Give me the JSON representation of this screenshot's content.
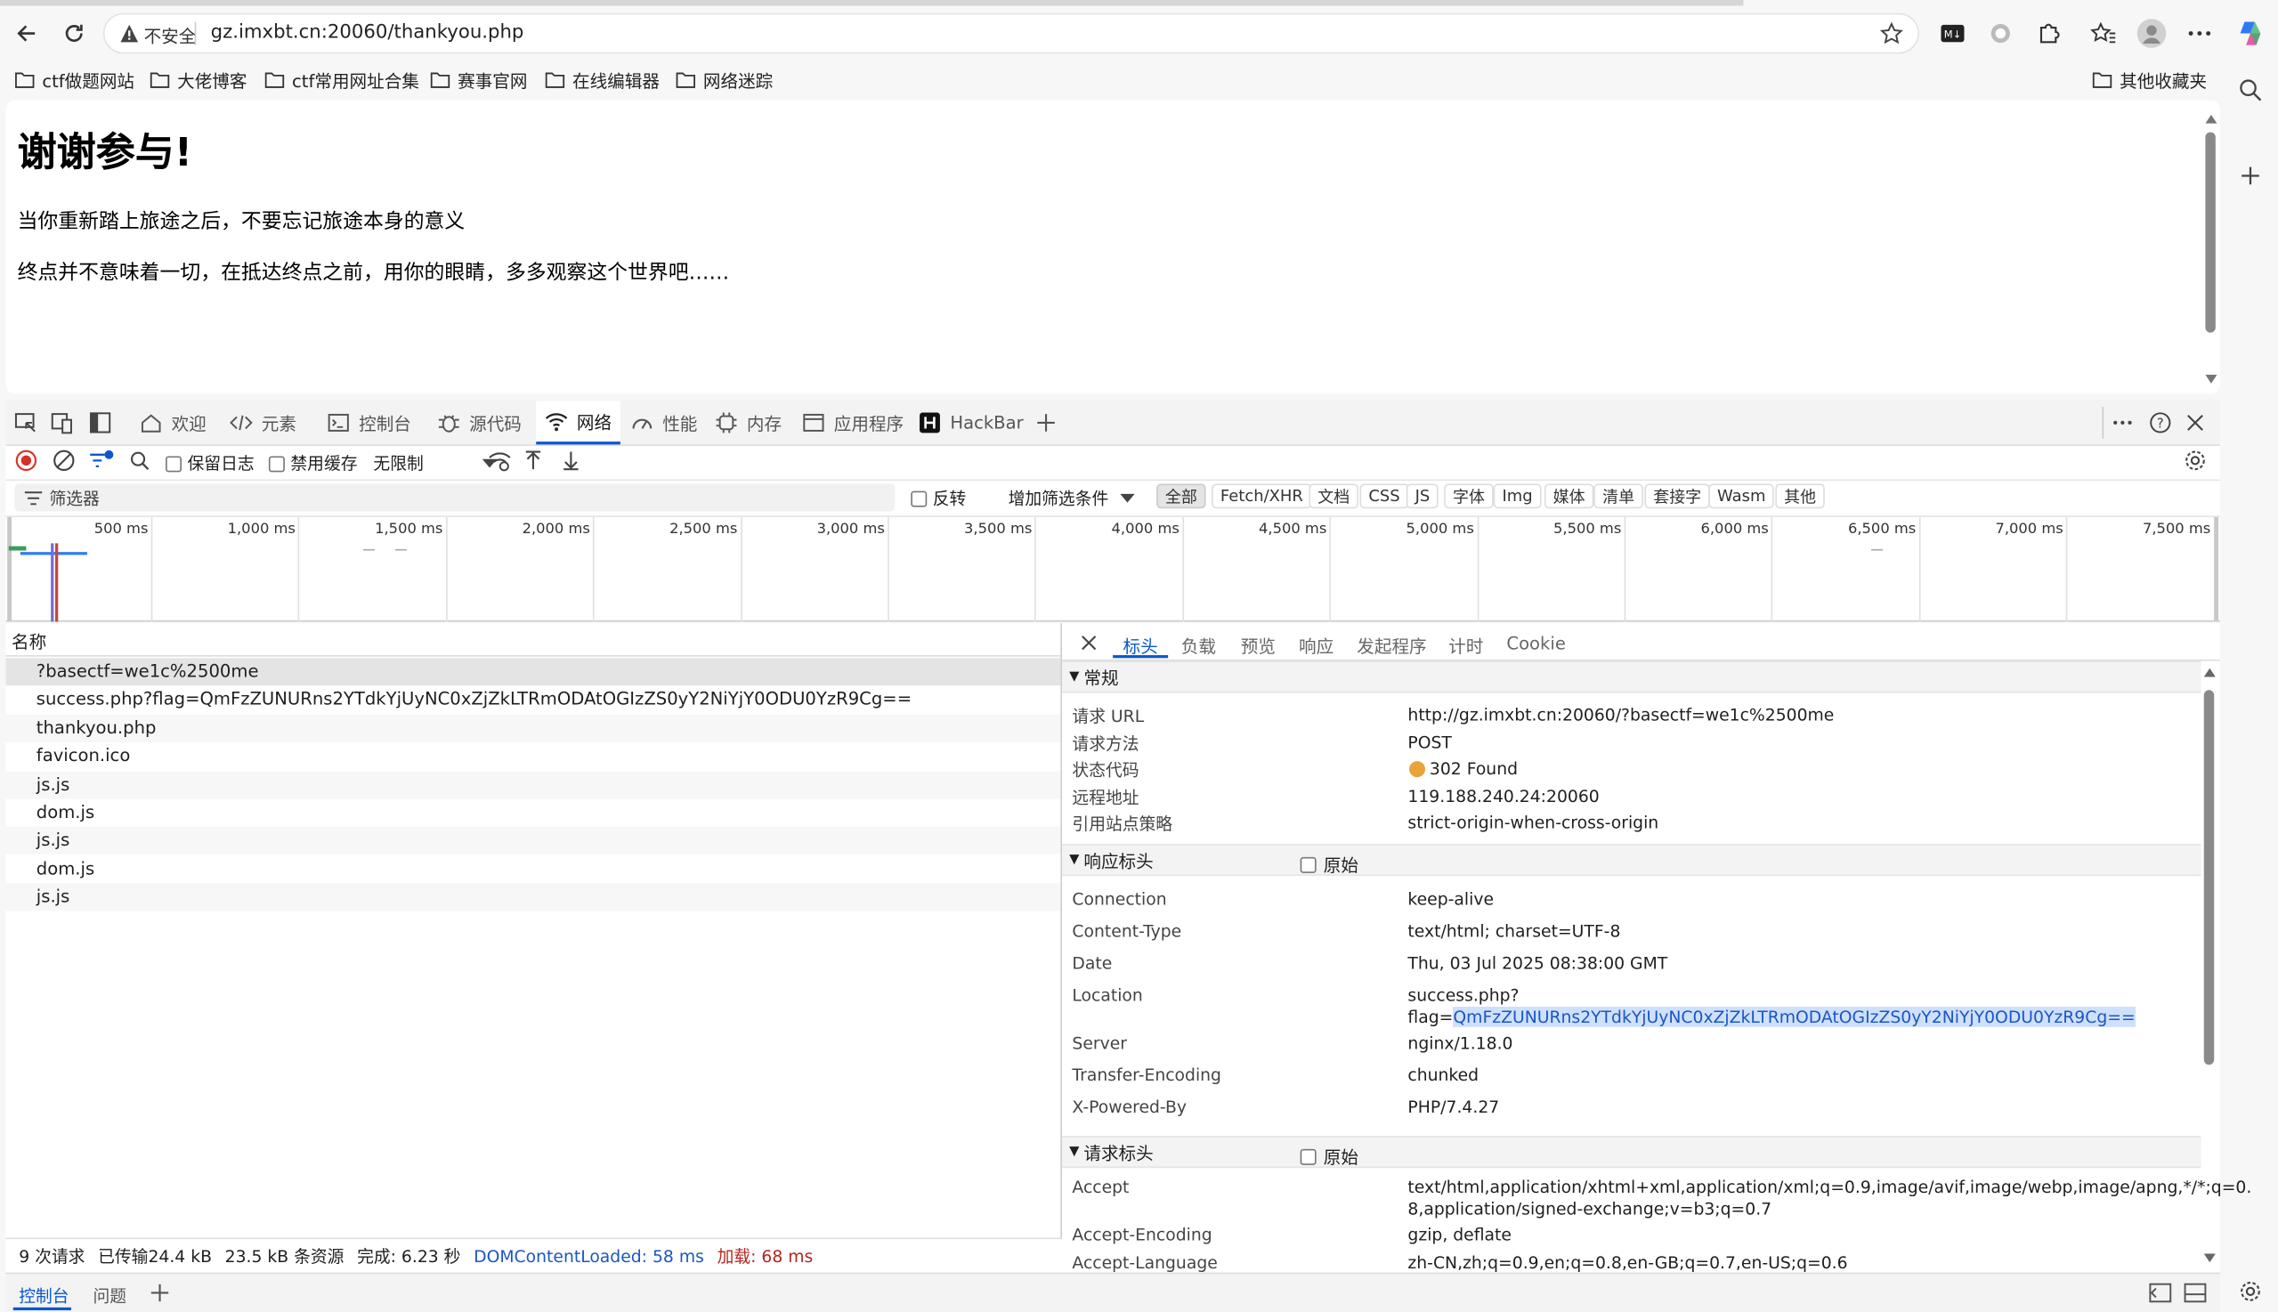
{
  "browser": {
    "insecure_label": "不安全",
    "url": "gz.imxbt.cn:20060/thankyou.php",
    "bookmarks": [
      "ctf做题网站",
      "大佬博客",
      "ctf常用网址合集",
      "赛事官网",
      "在线编辑器",
      "网络迷踪"
    ],
    "other_bookmarks": "其他收藏夹"
  },
  "page": {
    "heading": "谢谢参与!",
    "para1": "当你重新踏上旅途之后，不要忘记旅途本身的意义",
    "para2": "终点并不意味着一切，在抵达终点之前，用你的眼睛，多多观察这个世界吧……"
  },
  "devtools": {
    "tabs": [
      "欢迎",
      "元素",
      "控制台",
      "源代码",
      "网络",
      "性能",
      "内存",
      "应用程序",
      "HackBar"
    ],
    "active_tab": "网络",
    "toolbar": {
      "preserve_log": "保留日志",
      "disable_cache": "禁用缓存",
      "throttle": "无限制"
    },
    "filter": {
      "placeholder": "筛选器",
      "invert": "反转",
      "more_filters": "增加筛选条件"
    },
    "type_filters": [
      "全部",
      "Fetch/XHR",
      "文档",
      "CSS",
      "JS",
      "字体",
      "Img",
      "媒体",
      "清单",
      "套接字",
      "Wasm",
      "其他"
    ],
    "timeline_ticks": [
      "500 ms",
      "1,000 ms",
      "1,500 ms",
      "2,000 ms",
      "2,500 ms",
      "3,000 ms",
      "3,500 ms",
      "4,000 ms",
      "4,500 ms",
      "5,000 ms",
      "5,500 ms",
      "6,000 ms",
      "6,500 ms",
      "7,000 ms",
      "7,500 ms"
    ],
    "name_header": "名称",
    "requests": [
      "?basectf=we1c%2500me",
      "success.php?flag=QmFzZUNURns2YTdkYjUyNC0xZjZkLTRmODAtOGIzZS0yY2NiYjY0ODU0YzR9Cg==",
      "thankyou.php",
      "favicon.ico",
      "js.js",
      "dom.js",
      "js.js",
      "dom.js",
      "js.js"
    ],
    "status_bar": {
      "requests": "9 次请求",
      "transferred": "已传输24.4 kB",
      "resources": "23.5 kB 条资源",
      "finish": "完成: 6.23 秒",
      "dcl": "DOMContentLoaded: 58 ms",
      "load": "加载: 68 ms"
    },
    "detail_tabs": [
      "标头",
      "负载",
      "预览",
      "响应",
      "发起程序",
      "计时",
      "Cookie"
    ],
    "general": {
      "title": "常规",
      "rows": [
        {
          "k": "请求 URL",
          "v": "http://gz.imxbt.cn:20060/?basectf=we1c%2500me"
        },
        {
          "k": "请求方法",
          "v": "POST"
        },
        {
          "k": "状态代码",
          "v": "302 Found"
        },
        {
          "k": "远程地址",
          "v": "119.188.240.24:20060"
        },
        {
          "k": "引用站点策略",
          "v": "strict-origin-when-cross-origin"
        }
      ]
    },
    "response_headers": {
      "title": "响应标头",
      "raw": "原始",
      "rows": [
        {
          "k": "Connection",
          "v": "keep-alive"
        },
        {
          "k": "Content-Type",
          "v": "text/html; charset=UTF-8"
        },
        {
          "k": "Date",
          "v": "Thu, 03 Jul 2025 08:38:00 GMT"
        },
        {
          "k": "Location",
          "v": "success.php?"
        },
        {
          "k": "Server",
          "v": "nginx/1.18.0"
        },
        {
          "k": "Transfer-Encoding",
          "v": "chunked"
        },
        {
          "k": "X-Powered-By",
          "v": "PHP/7.4.27"
        }
      ],
      "location_prefix": "flag=",
      "location_value": "QmFzZUNURns2YTdkYjUyNC0xZjZkLTRmODAtOGIzZS0yY2NiYjY0ODU0YzR9Cg=="
    },
    "request_headers": {
      "title": "请求标头",
      "raw": "原始",
      "rows": [
        {
          "k": "Accept",
          "v": "text/html,application/xhtml+xml,application/xml;q=0.9,image/avif,image/webp,image/apng,*/*;q=0."
        },
        {
          "k": "Accept-Encoding",
          "v": "gzip, deflate"
        },
        {
          "k": "Accept-Language",
          "v": "zh-CN,zh;q=0.9,en;q=0.8,en-GB;q=0.7,en-US;q=0.6"
        }
      ],
      "accept_line2": "8,application/signed-exchange;v=b3;q=0.7"
    },
    "drawer_tabs": [
      "控制台",
      "问题"
    ],
    "status_dot_color": "#e8a33a",
    "accent": "#0b57d0"
  }
}
